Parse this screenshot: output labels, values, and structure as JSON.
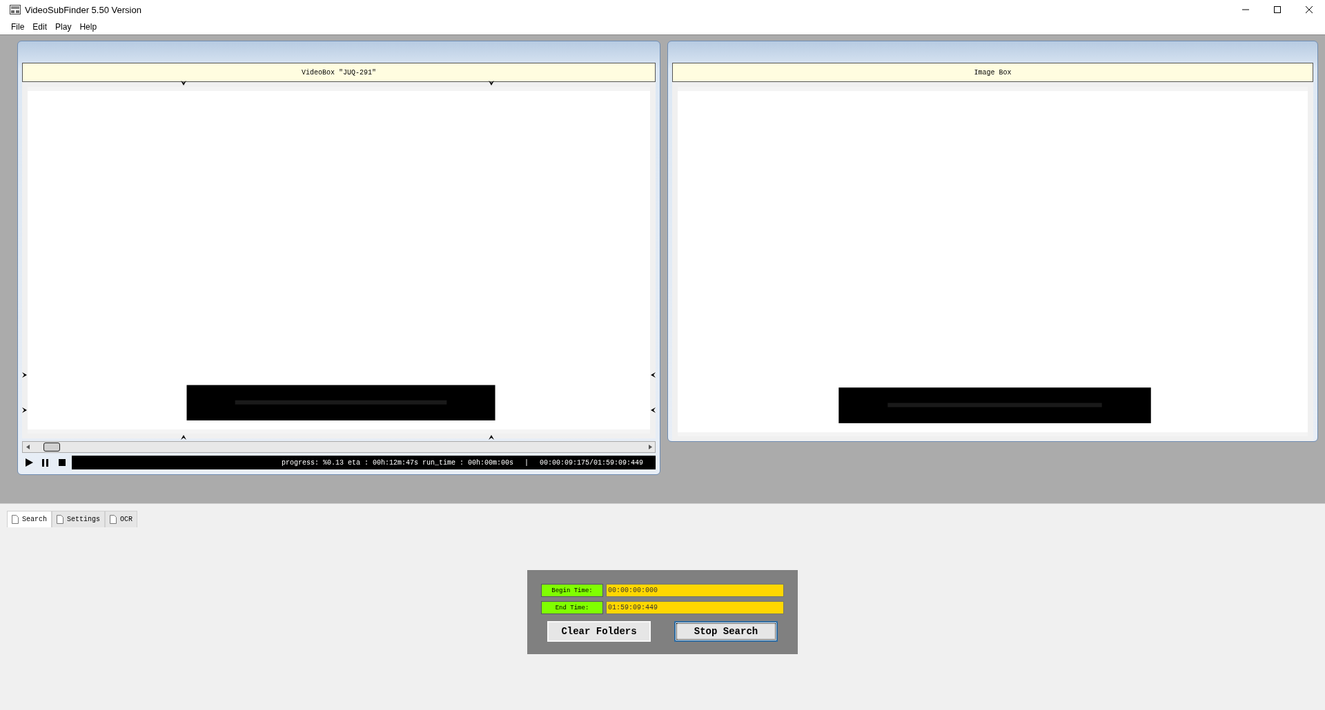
{
  "window": {
    "title": "VideoSubFinder 5.50 Version"
  },
  "menu": [
    "File",
    "Edit",
    "Play",
    "Help"
  ],
  "video_box": {
    "title": "VideoBox \"JUQ-291\"",
    "progress": "progress: %0.13 eta : 00h:12m:47s run_time : 00h:00m:00s",
    "separator": "|",
    "time": "00:00:09:175/01:59:09:449"
  },
  "image_box": {
    "title": "Image Box"
  },
  "tabs": [
    {
      "label": "Search",
      "selected": true
    },
    {
      "label": "Settings",
      "selected": false
    },
    {
      "label": "OCR",
      "selected": false
    }
  ],
  "search_panel": {
    "fields": [
      {
        "label": "Begin Time:",
        "value": "00:00:00:000"
      },
      {
        "label": "End Time:",
        "value": "01:59:09:449"
      }
    ],
    "buttons": [
      {
        "label": "Clear Folders",
        "focused": false
      },
      {
        "label": "Stop Search",
        "focused": true
      }
    ]
  }
}
